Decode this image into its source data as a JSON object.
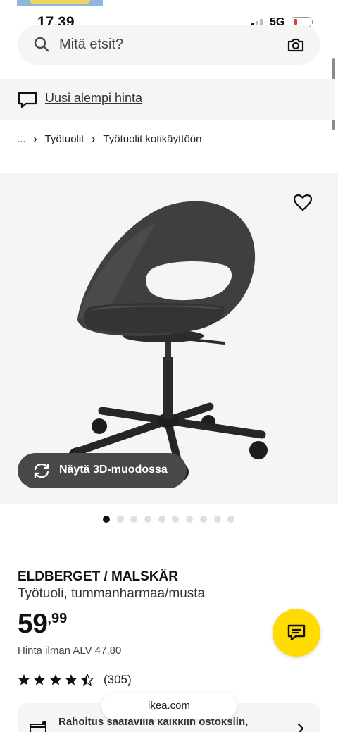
{
  "status_bar": {
    "time": "17.39",
    "network": "5G"
  },
  "search": {
    "placeholder": "Mitä etsit?"
  },
  "banner": {
    "link_text": "Uusi alempi hinta"
  },
  "breadcrumb": {
    "items": [
      "...",
      "Työtuolit",
      "Työtuolit kotikäyttöön"
    ]
  },
  "gallery": {
    "view_3d_label": "Näytä 3D-muodossa",
    "image_count": 10,
    "active_index": 0
  },
  "product": {
    "name": "ELDBERGET / MALSKÄR",
    "description": "Työtuoli, tummanharmaa/musta",
    "price_main": "59",
    "price_decimals": ",99",
    "price_vat_text": "Hinta ilman ALV 47,80",
    "rating": 4.5,
    "review_count": "(305)"
  },
  "financing": {
    "text": "Rahoitus saatavilla kaikkiin ostoksiin,"
  },
  "browser": {
    "url": "ikea.com"
  },
  "colors": {
    "brand_yellow": "#ffdb00",
    "chip_dark": "#484848",
    "battery_low": "#e53935"
  }
}
